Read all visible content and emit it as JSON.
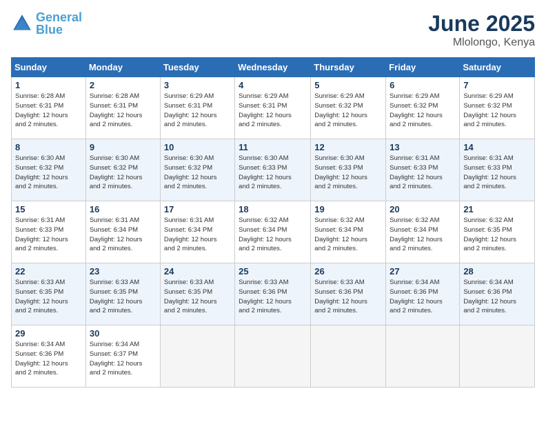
{
  "logo": {
    "line1": "General",
    "line2": "Blue"
  },
  "title": "June 2025",
  "location": "Mlolongo, Kenya",
  "weekdays": [
    "Sunday",
    "Monday",
    "Tuesday",
    "Wednesday",
    "Thursday",
    "Friday",
    "Saturday"
  ],
  "weeks": [
    [
      {
        "day": "1",
        "info": "Sunrise: 6:28 AM\nSunset: 6:31 PM\nDaylight: 12 hours\nand 2 minutes."
      },
      {
        "day": "2",
        "info": "Sunrise: 6:28 AM\nSunset: 6:31 PM\nDaylight: 12 hours\nand 2 minutes."
      },
      {
        "day": "3",
        "info": "Sunrise: 6:29 AM\nSunset: 6:31 PM\nDaylight: 12 hours\nand 2 minutes."
      },
      {
        "day": "4",
        "info": "Sunrise: 6:29 AM\nSunset: 6:31 PM\nDaylight: 12 hours\nand 2 minutes."
      },
      {
        "day": "5",
        "info": "Sunrise: 6:29 AM\nSunset: 6:32 PM\nDaylight: 12 hours\nand 2 minutes."
      },
      {
        "day": "6",
        "info": "Sunrise: 6:29 AM\nSunset: 6:32 PM\nDaylight: 12 hours\nand 2 minutes."
      },
      {
        "day": "7",
        "info": "Sunrise: 6:29 AM\nSunset: 6:32 PM\nDaylight: 12 hours\nand 2 minutes."
      }
    ],
    [
      {
        "day": "8",
        "info": "Sunrise: 6:30 AM\nSunset: 6:32 PM\nDaylight: 12 hours\nand 2 minutes."
      },
      {
        "day": "9",
        "info": "Sunrise: 6:30 AM\nSunset: 6:32 PM\nDaylight: 12 hours\nand 2 minutes."
      },
      {
        "day": "10",
        "info": "Sunrise: 6:30 AM\nSunset: 6:32 PM\nDaylight: 12 hours\nand 2 minutes."
      },
      {
        "day": "11",
        "info": "Sunrise: 6:30 AM\nSunset: 6:33 PM\nDaylight: 12 hours\nand 2 minutes."
      },
      {
        "day": "12",
        "info": "Sunrise: 6:30 AM\nSunset: 6:33 PM\nDaylight: 12 hours\nand 2 minutes."
      },
      {
        "day": "13",
        "info": "Sunrise: 6:31 AM\nSunset: 6:33 PM\nDaylight: 12 hours\nand 2 minutes."
      },
      {
        "day": "14",
        "info": "Sunrise: 6:31 AM\nSunset: 6:33 PM\nDaylight: 12 hours\nand 2 minutes."
      }
    ],
    [
      {
        "day": "15",
        "info": "Sunrise: 6:31 AM\nSunset: 6:33 PM\nDaylight: 12 hours\nand 2 minutes."
      },
      {
        "day": "16",
        "info": "Sunrise: 6:31 AM\nSunset: 6:34 PM\nDaylight: 12 hours\nand 2 minutes."
      },
      {
        "day": "17",
        "info": "Sunrise: 6:31 AM\nSunset: 6:34 PM\nDaylight: 12 hours\nand 2 minutes."
      },
      {
        "day": "18",
        "info": "Sunrise: 6:32 AM\nSunset: 6:34 PM\nDaylight: 12 hours\nand 2 minutes."
      },
      {
        "day": "19",
        "info": "Sunrise: 6:32 AM\nSunset: 6:34 PM\nDaylight: 12 hours\nand 2 minutes."
      },
      {
        "day": "20",
        "info": "Sunrise: 6:32 AM\nSunset: 6:34 PM\nDaylight: 12 hours\nand 2 minutes."
      },
      {
        "day": "21",
        "info": "Sunrise: 6:32 AM\nSunset: 6:35 PM\nDaylight: 12 hours\nand 2 minutes."
      }
    ],
    [
      {
        "day": "22",
        "info": "Sunrise: 6:33 AM\nSunset: 6:35 PM\nDaylight: 12 hours\nand 2 minutes."
      },
      {
        "day": "23",
        "info": "Sunrise: 6:33 AM\nSunset: 6:35 PM\nDaylight: 12 hours\nand 2 minutes."
      },
      {
        "day": "24",
        "info": "Sunrise: 6:33 AM\nSunset: 6:35 PM\nDaylight: 12 hours\nand 2 minutes."
      },
      {
        "day": "25",
        "info": "Sunrise: 6:33 AM\nSunset: 6:36 PM\nDaylight: 12 hours\nand 2 minutes."
      },
      {
        "day": "26",
        "info": "Sunrise: 6:33 AM\nSunset: 6:36 PM\nDaylight: 12 hours\nand 2 minutes."
      },
      {
        "day": "27",
        "info": "Sunrise: 6:34 AM\nSunset: 6:36 PM\nDaylight: 12 hours\nand 2 minutes."
      },
      {
        "day": "28",
        "info": "Sunrise: 6:34 AM\nSunset: 6:36 PM\nDaylight: 12 hours\nand 2 minutes."
      }
    ],
    [
      {
        "day": "29",
        "info": "Sunrise: 6:34 AM\nSunset: 6:36 PM\nDaylight: 12 hours\nand 2 minutes."
      },
      {
        "day": "30",
        "info": "Sunrise: 6:34 AM\nSunset: 6:37 PM\nDaylight: 12 hours\nand 2 minutes."
      },
      null,
      null,
      null,
      null,
      null
    ]
  ]
}
